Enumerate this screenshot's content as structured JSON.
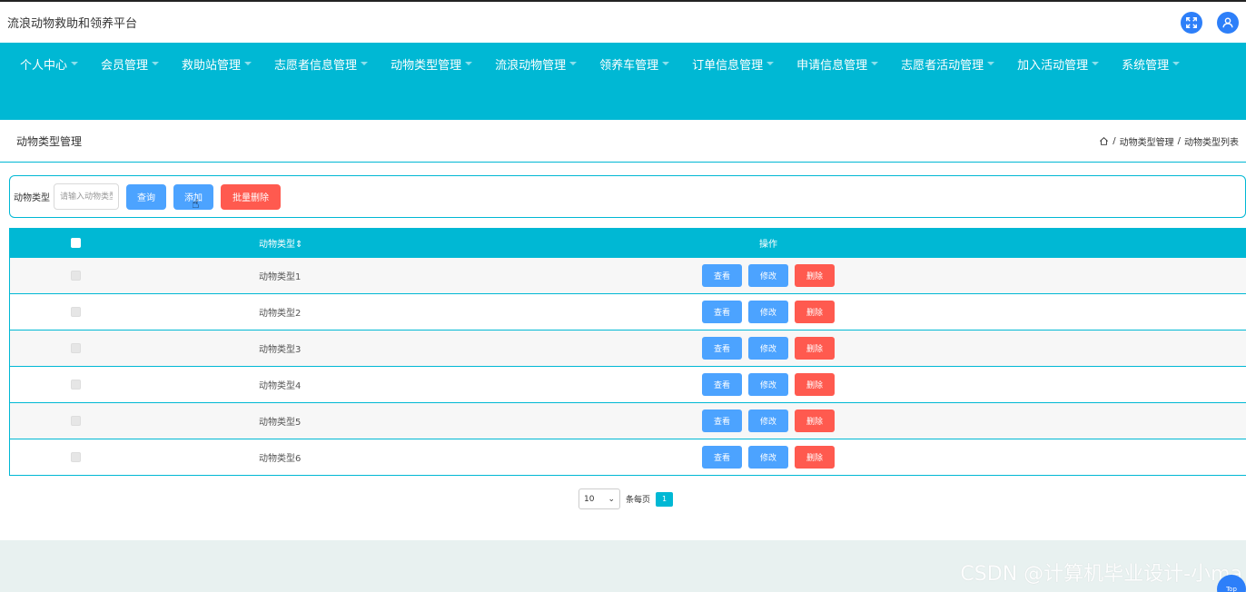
{
  "app": {
    "title": "流浪动物救助和领养平台"
  },
  "nav": {
    "items": [
      "个人中心",
      "会员管理",
      "救助站管理",
      "志愿者信息管理",
      "动物类型管理",
      "流浪动物管理",
      "领养车管理",
      "订单信息管理",
      "申请信息管理",
      "志愿者活动管理",
      "加入活动管理",
      "系统管理"
    ]
  },
  "page": {
    "section_title": "动物类型管理",
    "breadcrumb": [
      "动物类型管理",
      "动物类型列表"
    ],
    "breadcrumb_sep": "/"
  },
  "search": {
    "label": "动物类型",
    "placeholder": "请输入动物类型",
    "query_label": "查询",
    "add_label": "添加",
    "batch_delete_label": "批量删除"
  },
  "table": {
    "headers": {
      "type": "动物类型⇕",
      "ops": "操作"
    },
    "rows": [
      "动物类型1",
      "动物类型2",
      "动物类型3",
      "动物类型4",
      "动物类型5",
      "动物类型6"
    ],
    "actions": {
      "view": "查看",
      "edit": "修改",
      "delete": "删除"
    }
  },
  "pagination": {
    "page_size": "10",
    "per_page_label": "条每页",
    "current_page": "1"
  },
  "footer": {
    "watermark": "CSDN @计算机毕业设计-小ma",
    "top_label": "Top"
  },
  "colors": {
    "primary": "#00b8d4",
    "blue_button": "#4ca3ff",
    "red_button": "#ff5a4f",
    "icon_blue": "#2d7ff9"
  },
  "icons": {
    "fullscreen": "expand-icon",
    "user": "user-icon",
    "home": "home-icon",
    "caret": "caret-down-icon"
  }
}
